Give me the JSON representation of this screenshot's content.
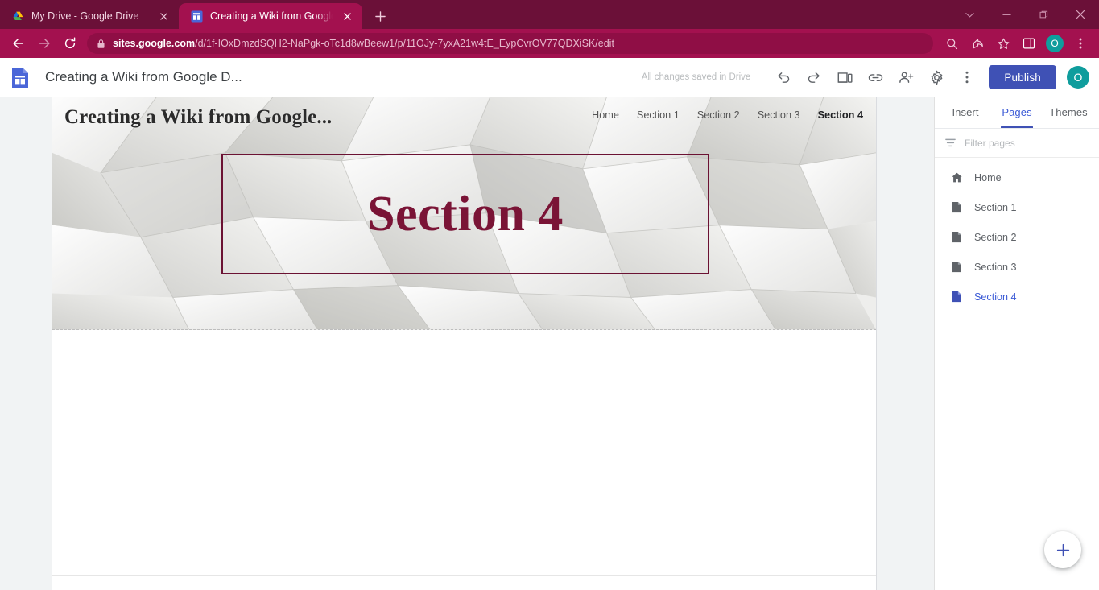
{
  "browser": {
    "tabs": [
      {
        "title": "My Drive - Google Drive",
        "favicon": "google-drive-icon",
        "active": false
      },
      {
        "title": "Creating a Wiki from Google Doc",
        "favicon": "google-sites-icon",
        "active": true
      }
    ],
    "new_tab_label": "+",
    "window_controls": [
      "chevron-down-icon",
      "minimize-icon",
      "maximize-icon",
      "close-icon"
    ],
    "nav": {
      "back": "back-icon",
      "forward": "forward-icon",
      "reload": "reload-icon"
    },
    "omnibox": {
      "lock": "lock-icon",
      "url_domain": "sites.google.com",
      "url_path": "/d/1f-IOxDmzdSQH2-NaPgk-oTc1d8wBeew1/p/11OJy-7yxA21w4tE_EypCvrOV77QDXiSK/edit"
    },
    "toolbar_right": [
      "search-icon",
      "share-icon",
      "bookmark-star-icon",
      "side-panel-icon"
    ],
    "profile_initial": "O",
    "menu": "three-dot-menu-icon",
    "colors": {
      "tabstrip": "#6b1038",
      "toolbar": "#a3114f",
      "omnibox": "#8f0e45",
      "avatar": "#0f9d9d"
    }
  },
  "sites": {
    "logo": "google-sites-logo-icon",
    "doc_title": "Creating a Wiki from Google D...",
    "save_status": "All changes saved in Drive",
    "toolbar_icons": [
      {
        "name": "undo-icon",
        "label": "Undo"
      },
      {
        "name": "redo-icon",
        "label": "Redo"
      },
      {
        "name": "preview-icon",
        "label": "Preview"
      },
      {
        "name": "copy-link-icon",
        "label": "Copy page link"
      },
      {
        "name": "share-with-others-icon",
        "label": "Share with others"
      },
      {
        "name": "settings-gear-icon",
        "label": "Settings"
      },
      {
        "name": "more-options-icon",
        "label": "More"
      }
    ],
    "publish_label": "Publish",
    "account_initial": "O",
    "accent_color": "#3f51b5"
  },
  "site_page": {
    "banner_title": "Creating a Wiki from Google...",
    "nav_links": [
      {
        "label": "Home",
        "current": false
      },
      {
        "label": "Section 1",
        "current": false
      },
      {
        "label": "Section 2",
        "current": false
      },
      {
        "label": "Section 3",
        "current": false
      },
      {
        "label": "Section 4",
        "current": true
      }
    ],
    "section_heading": "Section 4",
    "heading_color": "#7a1436",
    "selection_box_color": "#6b1233"
  },
  "panel": {
    "tabs": [
      {
        "label": "Insert",
        "active": false
      },
      {
        "label": "Pages",
        "active": true
      },
      {
        "label": "Themes",
        "active": false
      }
    ],
    "filter": {
      "icon": "filter-icon",
      "placeholder": "Filter pages"
    },
    "pages": [
      {
        "label": "Home",
        "icon": "home-icon",
        "active": false
      },
      {
        "label": "Section 1",
        "icon": "page-icon",
        "active": false
      },
      {
        "label": "Section 2",
        "icon": "page-icon",
        "active": false
      },
      {
        "label": "Section 3",
        "icon": "page-icon",
        "active": false
      },
      {
        "label": "Section 4",
        "icon": "page-icon",
        "active": true
      }
    ],
    "add_button": {
      "icon": "plus-icon",
      "label": "New page"
    }
  }
}
